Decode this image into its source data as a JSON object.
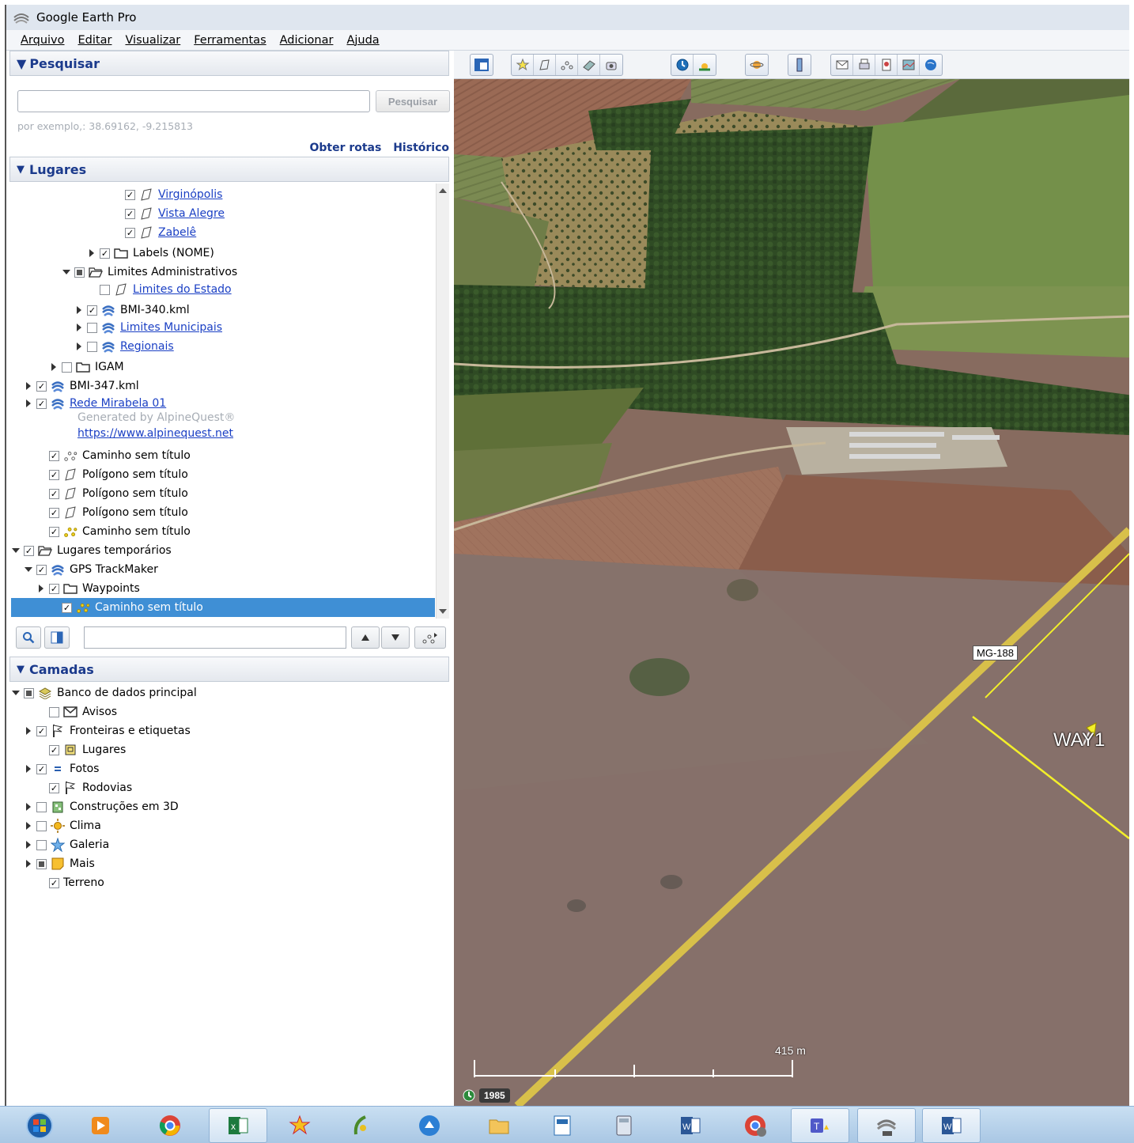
{
  "app": {
    "title": "Google Earth Pro"
  },
  "menu": [
    "Arquivo",
    "Editar",
    "Visualizar",
    "Ferramentas",
    "Adicionar",
    "Ajuda"
  ],
  "search": {
    "header": "Pesquisar",
    "input_value": "",
    "button": "Pesquisar",
    "hint": "por exemplo,: 38.69162, -9.215813",
    "link_routes": "Obter rotas",
    "link_history": "Histórico"
  },
  "places": {
    "header": "Lugares",
    "rows": [
      {
        "label": "Virginópolis",
        "link": true,
        "checked": "on",
        "icon": "polygon-icon"
      },
      {
        "label": "Vista Alegre",
        "link": true,
        "checked": "on",
        "icon": "polygon-icon"
      },
      {
        "label": "Zabelê",
        "link": true,
        "checked": "on",
        "icon": "polygon-icon"
      },
      {
        "label": "Labels (NOME)",
        "checked": "on",
        "icon": "folder-icon",
        "expand": "r"
      },
      {
        "label": "Limites Administrativos",
        "checked": "partial",
        "icon": "folder-open-icon",
        "expand": "d"
      },
      {
        "label": "Limites do Estado",
        "link": true,
        "checked": "off",
        "icon": "polygon-icon"
      },
      {
        "label": "BMI-340.kml",
        "checked": "on",
        "icon": "earth-icon",
        "expand": "r"
      },
      {
        "label": "Limites Municipais",
        "link": true,
        "checked": "off",
        "icon": "earth-icon",
        "expand": "r"
      },
      {
        "label": "Regionais",
        "link": true,
        "checked": "off",
        "icon": "earth-icon",
        "expand": "r"
      },
      {
        "label": "IGAM",
        "checked": "off",
        "icon": "folder-icon",
        "expand": "r"
      },
      {
        "label": "BMI-347.kml",
        "checked": "on",
        "icon": "earth-icon",
        "expand": "r"
      },
      {
        "label": "Rede Mirabela 01",
        "link": true,
        "checked": "on",
        "icon": "earth-icon",
        "expand": "r"
      },
      {
        "label": "Generated by AlpineQuest®",
        "note": true
      },
      {
        "label": "https://www.alpinequest.net",
        "link": true,
        "note": true
      },
      {
        "label": "Caminho sem título",
        "checked": "on",
        "icon": "path-icon"
      },
      {
        "label": "Polígono sem título",
        "checked": "on",
        "icon": "polygon-icon"
      },
      {
        "label": "Polígono sem título",
        "checked": "on",
        "icon": "polygon-icon"
      },
      {
        "label": "Polígono sem título",
        "checked": "on",
        "icon": "polygon-icon"
      },
      {
        "label": "Caminho sem título",
        "checked": "on",
        "icon": "path-yellow-icon"
      },
      {
        "label": "Lugares temporários",
        "checked": "on",
        "icon": "folder-open-icon",
        "expand": "d"
      },
      {
        "label": "GPS TrackMaker",
        "checked": "on",
        "icon": "earth-icon",
        "expand": "d"
      },
      {
        "label": "Waypoints",
        "checked": "on",
        "icon": "folder-icon",
        "expand": "r"
      },
      {
        "label": "Caminho sem título",
        "checked": "on",
        "icon": "path-yellow-icon",
        "selected": true
      }
    ]
  },
  "layers": {
    "header": "Camadas",
    "rows": [
      {
        "label": "Banco de dados principal",
        "checked": "partial",
        "icon": "database-icon",
        "expand": "d"
      },
      {
        "label": "Avisos",
        "checked": "off",
        "icon": "envelope-icon"
      },
      {
        "label": "Fronteiras e etiquetas",
        "checked": "on",
        "icon": "flag-icon",
        "expand": "r"
      },
      {
        "label": "Lugares",
        "checked": "on",
        "icon": "places-icon"
      },
      {
        "label": "Fotos",
        "checked": "on",
        "icon": "photo-icon",
        "expand": "r"
      },
      {
        "label": "Rodovias",
        "checked": "on",
        "icon": "flag-icon"
      },
      {
        "label": "Construções em 3D",
        "checked": "off",
        "icon": "building-icon",
        "expand": "r"
      },
      {
        "label": "Clima",
        "checked": "off",
        "icon": "sun-icon",
        "expand": "r"
      },
      {
        "label": "Galeria",
        "checked": "off",
        "icon": "star-icon",
        "expand": "r"
      },
      {
        "label": "Mais",
        "checked": "partial",
        "icon": "note-icon",
        "expand": "r"
      },
      {
        "label": "Terreno",
        "checked": "on"
      }
    ]
  },
  "map": {
    "road_label": "MG-188",
    "waypoint_label": "WAY1",
    "scale_label": "415 m",
    "year": "1985"
  },
  "colors": {
    "panel_header_text": "#1b3a8c",
    "selection": "#3f8fd5",
    "link": "#1a3fc4",
    "road": "#d8c04a",
    "track": "#f2ef2a"
  },
  "taskbar": [
    "start-icon",
    "media-player-icon",
    "chrome-icon",
    "excel-icon",
    "app-icon",
    "qgis-icon",
    "app-blue-icon",
    "file-explorer-icon",
    "publisher-icon",
    "calculator-icon",
    "word-icon",
    "chrome-user-icon",
    "teams-icon",
    "google-earth-icon",
    "word-icon"
  ]
}
